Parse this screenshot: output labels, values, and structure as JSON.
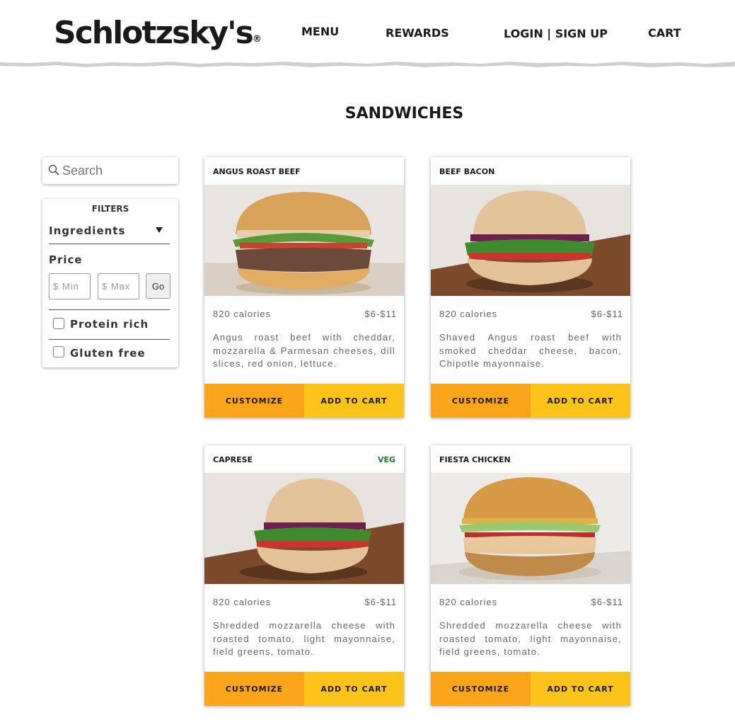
{
  "header": {
    "logo": "Schlotzsky's",
    "nav": {
      "menu": "MENU",
      "rewards": "REWARDS",
      "login": "LOGIN | SIGN UP",
      "cart": "CART"
    }
  },
  "page": {
    "title": "SANDWICHES"
  },
  "sidebar": {
    "search": {
      "placeholder": "Search",
      "icon": "search-icon"
    },
    "filters": {
      "title": "FILTERS",
      "ingredients_label": "Ingredients",
      "price_label": "Price",
      "min_placeholder": "$ Min",
      "max_placeholder": "$ Max",
      "go_label": "Go",
      "options": [
        {
          "label": "Protein rich",
          "checked": false
        },
        {
          "label": "Gluten free",
          "checked": false
        }
      ]
    }
  },
  "products": [
    {
      "name": "ANGUS ROAST BEEF",
      "tag": "",
      "calories": "820 calories",
      "price": "$6-$11",
      "description": "Angus roast beef with cheddar, mozzarella & Parmesan cheeses, dill slices, red onion, lettuce.",
      "customize_label": "CUSTOMIZE",
      "add_label": "ADD TO CART"
    },
    {
      "name": "BEEF BACON",
      "tag": "",
      "calories": "820 calories",
      "price": "$6-$11",
      "description": "Shaved Angus roast beef with smoked cheddar cheese, bacon, Chipotle mayonnaise.",
      "customize_label": "CUSTOMIZE",
      "add_label": "ADD TO CART"
    },
    {
      "name": "CAPRESE",
      "tag": "VEG",
      "calories": "820 calories",
      "price": "$6-$11",
      "description": "Shredded mozzarella cheese with roasted tomato, light mayonnaise, field greens, tomato.",
      "customize_label": "CUSTOMIZE",
      "add_label": "ADD TO CART"
    },
    {
      "name": "FIESTA CHICKEN",
      "tag": "",
      "calories": "820 calories",
      "price": "$6-$11",
      "description": "Shredded mozzarella cheese with roasted tomato, light mayonnaise, field greens, tomato.",
      "customize_label": "CUSTOMIZE",
      "add_label": "ADD TO CART"
    }
  ],
  "colors": {
    "customize_button": "#fba51b",
    "add_button": "#fcc419",
    "veg_tag": "#1b7a2f"
  }
}
